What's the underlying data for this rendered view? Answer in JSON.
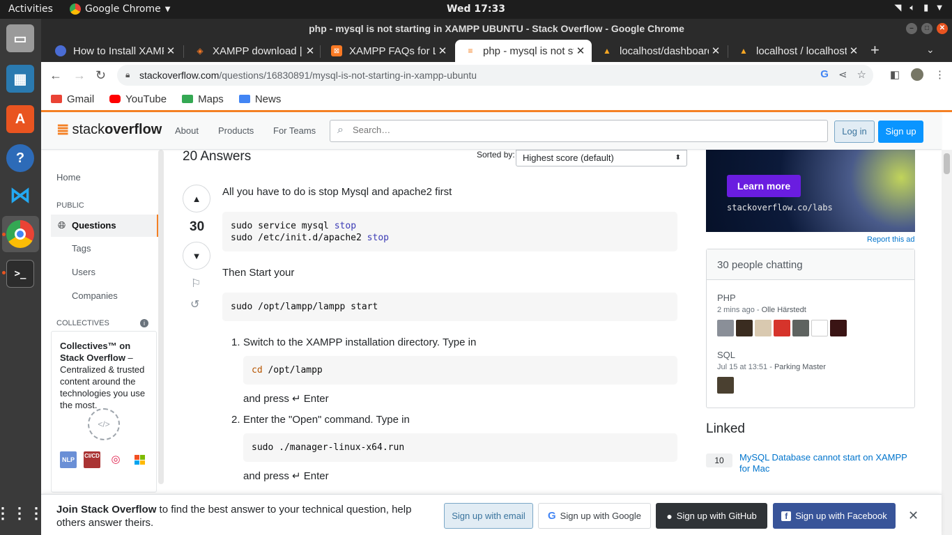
{
  "os": {
    "activities": "Activities",
    "app_name": "Google Chrome",
    "clock": "Wed 17:33"
  },
  "window": {
    "title": "php - mysql is not starting in XAMPP UBUNTU - Stack Overflow - Google Chrome"
  },
  "tabs": [
    {
      "label": "How to Install XAMPP",
      "icon": "globe-icon",
      "color": "#4a6cd4"
    },
    {
      "label": "XAMPP download | ",
      "icon": "diamond-icon",
      "color": "#fb7a24"
    },
    {
      "label": "XAMPP FAQs for Li",
      "icon": "xampp-icon",
      "color": "#fb7a24"
    },
    {
      "label": "php - mysql is not st",
      "icon": "stackoverflow-icon",
      "color": "#f48024"
    },
    {
      "label": "localhost/dashboard",
      "icon": "warning-icon",
      "color": "#f6a623"
    },
    {
      "label": "localhost / localhost",
      "icon": "warning-icon",
      "color": "#f6a623"
    }
  ],
  "address": {
    "domain": "stackoverflow.com",
    "path": "/questions/16830891/mysql-is-not-starting-in-xampp-ubuntu"
  },
  "bookmarks": [
    {
      "label": "Gmail",
      "color": "#ea4335"
    },
    {
      "label": "YouTube",
      "color": "#ff0000"
    },
    {
      "label": "Maps",
      "color": "#34a853"
    },
    {
      "label": "News",
      "color": "#4285f4"
    }
  ],
  "so_header": {
    "logo_light": "stack",
    "logo_bold": "overflow",
    "nav": [
      "About",
      "Products",
      "For Teams"
    ],
    "search_placeholder": "Search…",
    "login": "Log in",
    "signup": "Sign up"
  },
  "leftnav": {
    "home": "Home",
    "public": "PUBLIC",
    "questions": "Questions",
    "tags": "Tags",
    "users": "Users",
    "companies": "Companies",
    "collectives": "COLLECTIVES",
    "box_title": "Collectives™ on Stack Overflow",
    "box_dash": " –",
    "box_text": "Centralized & trusted content around the technologies you use the most.",
    "badges": [
      "NLP",
      "CI/CD"
    ]
  },
  "answers": {
    "count_label": "20 Answers",
    "sorted_by": "Sorted by:",
    "sort_value": "Highest score (default)",
    "score": "30",
    "intro": "All you have to do is stop Mysql and apache2 first",
    "code1_line1_cmd": "sudo service mysql ",
    "code1_line1_kw": "stop",
    "code1_line2_cmd": "sudo /etc/init.d/apache2 ",
    "code1_line2_kw": "stop",
    "then": "Then Start your",
    "code2": "sudo /opt/lampp/lampp start",
    "step1_num": "1.",
    "step1": "Switch to the XAMPP installation directory. Type in",
    "code3_kw": "cd",
    "code3_rest": " /opt/lampp",
    "press1": "and press ↵ Enter",
    "step2_num": "2.",
    "step2": "Enter the \"Open\" command. Type in",
    "code4": "sudo ./manager-linux-x64.run",
    "press2": "and press ↵ Enter"
  },
  "sidebar": {
    "ad_button": "Learn more",
    "ad_url": "stackoverflow.co/labs",
    "report": "Report this ad",
    "chat_title": "30 people chatting",
    "room1_name": "PHP",
    "room1_time": "2 mins ago",
    "room1_user": "Olle Härstedt",
    "room2_name": "SQL",
    "room2_time": "Jul 15 at 13:51",
    "room2_user": "Parking Master",
    "linked_title": "Linked",
    "linked_count": "10",
    "linked_text": "MySQL Database cannot start on XAMPP for Mac"
  },
  "banner": {
    "bold": "Join Stack Overflow",
    "rest": " to find the best answer to your technical question, help others answer theirs.",
    "email": "Sign up with email",
    "google": "Sign up with Google",
    "github": "Sign up with GitHub",
    "facebook": "Sign up with Facebook"
  },
  "colors": {
    "so_orange": "#f48024",
    "so_blue": "#0a95ff",
    "ubuntu_orange": "#e95420"
  }
}
